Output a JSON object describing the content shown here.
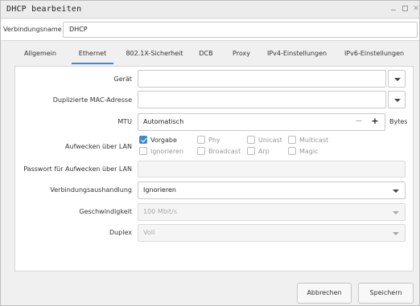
{
  "window": {
    "title": "DHCP bearbeiten"
  },
  "connection": {
    "name_label": "Verbindungsname",
    "name_value": "DHCP"
  },
  "tabs": [
    {
      "label": "Allgemein",
      "active": false
    },
    {
      "label": "Ethernet",
      "active": true
    },
    {
      "label": "802.1X-Sicherheit",
      "active": false
    },
    {
      "label": "DCB",
      "active": false
    },
    {
      "label": "Proxy",
      "active": false
    },
    {
      "label": "IPv4-Einstellungen",
      "active": false
    },
    {
      "label": "IPv6-Einstellungen",
      "active": false
    }
  ],
  "ethernet": {
    "device_label": "Gerät",
    "device_value": "",
    "mac_label": "Duplizierte MAC-Adresse",
    "mac_value": "",
    "mtu_label": "MTU",
    "mtu_value": "Automatisch",
    "mtu_unit": "Bytes",
    "wol_label": "Aufwecken über LAN",
    "wol_options": [
      {
        "label": "Vorgabe",
        "checked": true,
        "enabled": true
      },
      {
        "label": "Phy",
        "checked": false,
        "enabled": false
      },
      {
        "label": "Unicast",
        "checked": false,
        "enabled": false
      },
      {
        "label": "Multicast",
        "checked": false,
        "enabled": false
      },
      {
        "label": "Ignorieren",
        "checked": false,
        "enabled": false
      },
      {
        "label": "Broadcast",
        "checked": false,
        "enabled": false
      },
      {
        "label": "Arp",
        "checked": false,
        "enabled": false
      },
      {
        "label": "Magic",
        "checked": false,
        "enabled": false
      }
    ],
    "wol_password_label": "Passwort für Aufwecken über LAN",
    "wol_password_value": "",
    "negotiation_label": "Verbindungsaushandlung",
    "negotiation_value": "Ignorieren",
    "speed_label": "Geschwindigkeit",
    "speed_value": "100 Mbit/s",
    "duplex_label": "Duplex",
    "duplex_value": "Voll"
  },
  "buttons": {
    "cancel": "Abbrechen",
    "save": "Speichern"
  },
  "colors": {
    "accent": "#3b8ad6"
  }
}
